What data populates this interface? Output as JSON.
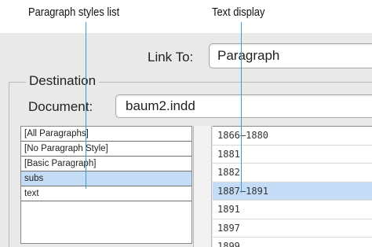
{
  "callouts": {
    "paragraph_styles_list": "Paragraph styles list",
    "text_display": "Text display"
  },
  "link_to": {
    "label": "Link To:",
    "value": "Paragraph"
  },
  "destination": {
    "legend": "Destination",
    "document_label": "Document:",
    "document_value": "baum2.indd"
  },
  "paragraph_styles": [
    {
      "label": "[All Paragraphs]",
      "selected": false
    },
    {
      "label": "[No Paragraph Style]",
      "selected": false
    },
    {
      "label": "[Basic Paragraph]",
      "selected": false
    },
    {
      "label": "subs",
      "selected": true
    },
    {
      "label": "text",
      "selected": false
    }
  ],
  "text_entries": [
    {
      "label": "1866–1880",
      "selected": false
    },
    {
      "label": "1881",
      "selected": false
    },
    {
      "label": "1882",
      "selected": false
    },
    {
      "label": "1887–1891",
      "selected": true
    },
    {
      "label": "1891",
      "selected": false
    },
    {
      "label": "1897",
      "selected": false
    },
    {
      "label": "1899",
      "selected": false
    }
  ]
}
